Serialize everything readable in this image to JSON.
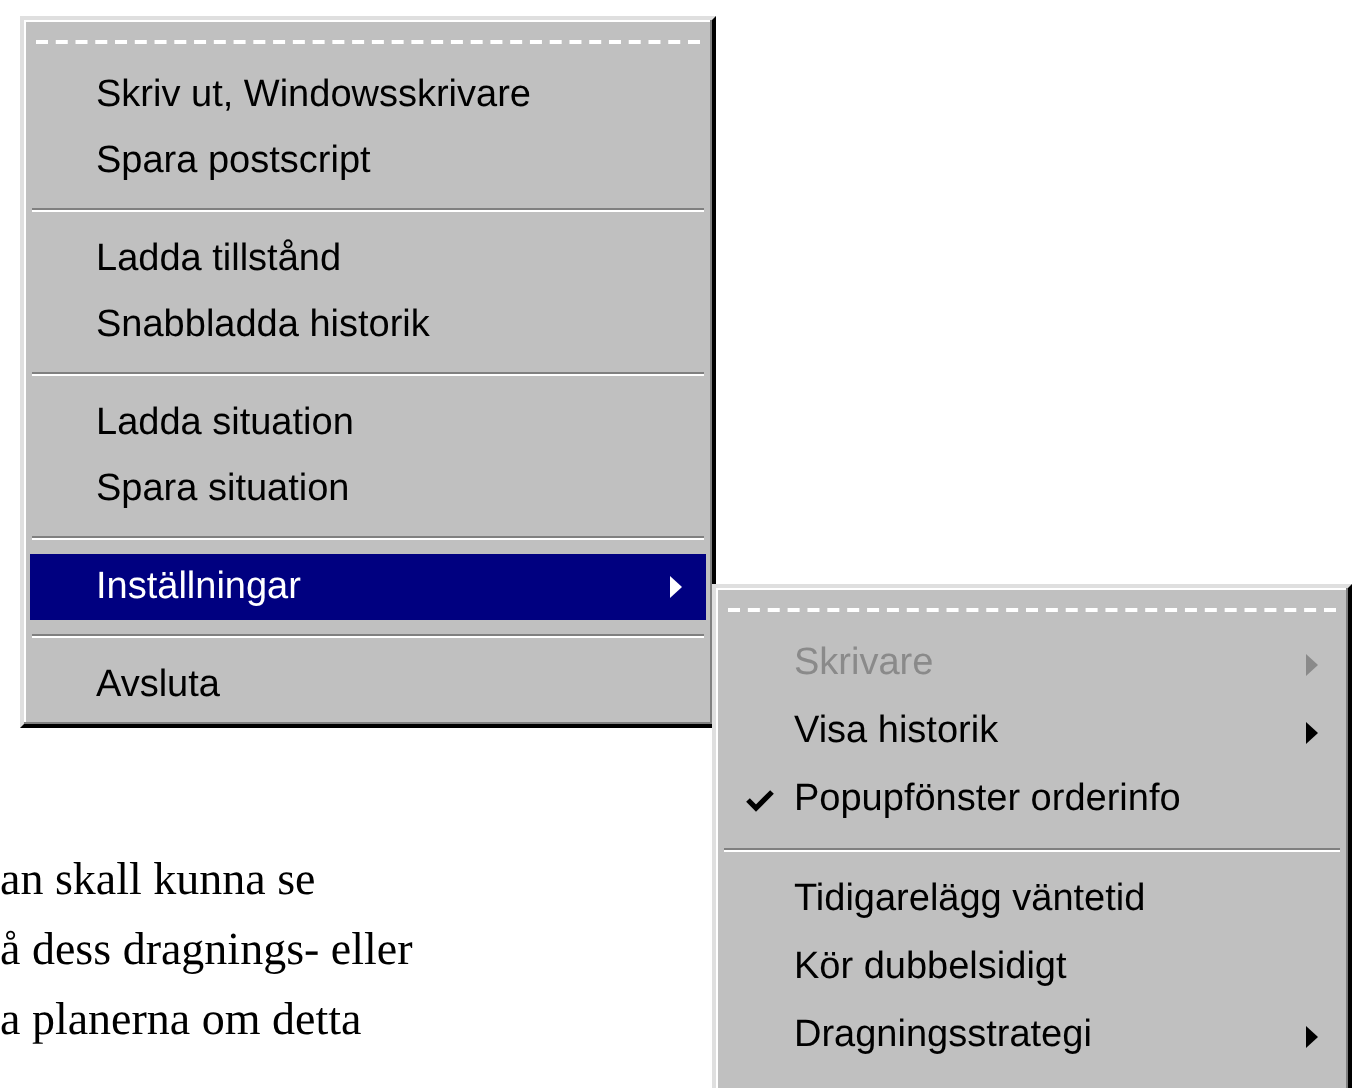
{
  "document": {
    "lines": [
      "an skall kunna se",
      "å dess dragnings- eller",
      "a planerna om detta"
    ]
  },
  "menu": {
    "items": [
      {
        "kind": "item",
        "label": "Skriv ut, Windowsskrivare",
        "selected": false,
        "submenu": false
      },
      {
        "kind": "item",
        "label": "Spara postscript",
        "selected": false,
        "submenu": false
      },
      {
        "kind": "separator"
      },
      {
        "kind": "item",
        "label": "Ladda tillstånd",
        "selected": false,
        "submenu": false
      },
      {
        "kind": "item",
        "label": "Snabbladda historik",
        "selected": false,
        "submenu": false
      },
      {
        "kind": "separator"
      },
      {
        "kind": "item",
        "label": "Ladda situation",
        "selected": false,
        "submenu": false
      },
      {
        "kind": "item",
        "label": "Spara situation",
        "selected": false,
        "submenu": false
      },
      {
        "kind": "separator"
      },
      {
        "kind": "item",
        "label": "Inställningar",
        "selected": true,
        "submenu": true
      },
      {
        "kind": "separator"
      },
      {
        "kind": "item",
        "label": "Avsluta",
        "selected": false,
        "submenu": false
      }
    ]
  },
  "submenu": {
    "items": [
      {
        "kind": "item",
        "label": "Skrivare",
        "selected": false,
        "disabled": true,
        "checked": false,
        "submenu": true
      },
      {
        "kind": "item",
        "label": "Visa historik",
        "selected": false,
        "disabled": false,
        "checked": false,
        "submenu": true
      },
      {
        "kind": "item",
        "label": "Popupfönster orderinfo",
        "selected": false,
        "disabled": false,
        "checked": true,
        "submenu": false
      },
      {
        "kind": "separator"
      },
      {
        "kind": "item",
        "label": "Tidigarelägg väntetid",
        "selected": false,
        "disabled": false,
        "checked": false,
        "submenu": false
      },
      {
        "kind": "item",
        "label": "Kör dubbelsidigt",
        "selected": false,
        "disabled": false,
        "checked": false,
        "submenu": false
      },
      {
        "kind": "item",
        "label": "Dragningsstrategi",
        "selected": false,
        "disabled": false,
        "checked": false,
        "submenu": true
      }
    ]
  }
}
